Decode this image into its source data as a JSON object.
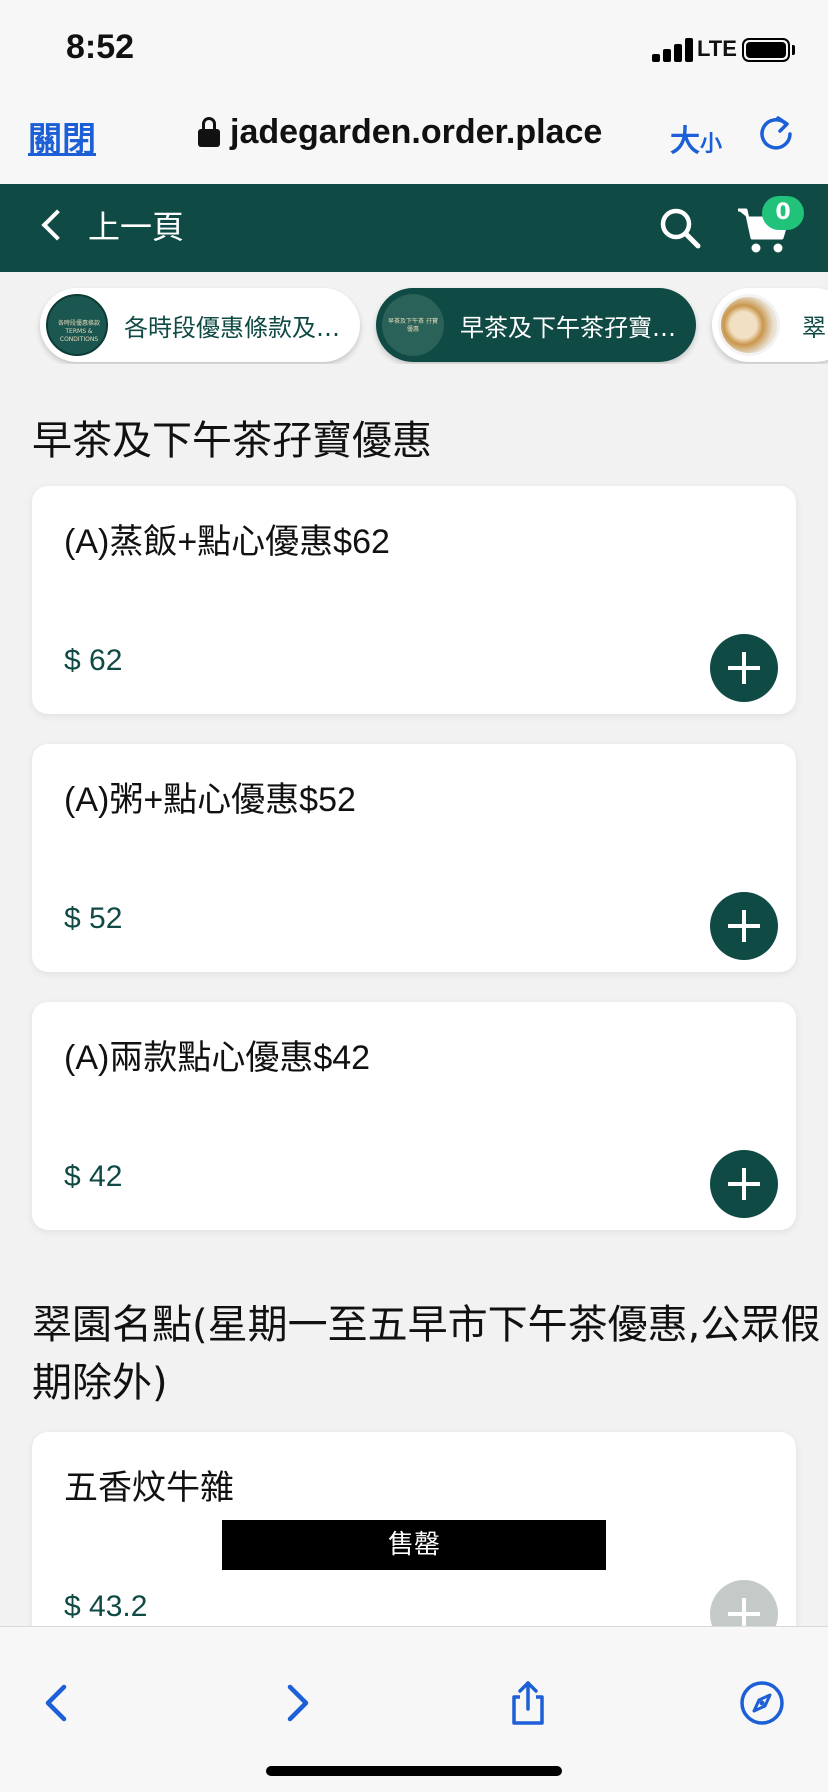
{
  "status_bar": {
    "time": "8:52",
    "network": "LTE"
  },
  "browser": {
    "close_label": "關閉",
    "url": "jadegarden.order.place",
    "text_size_label_big": "大",
    "text_size_label_small": "小"
  },
  "header": {
    "back_label": "上一頁",
    "cart_count": "0"
  },
  "chips": [
    {
      "label": "各時段優惠條款及細則",
      "thumb_text": "各時段優惠條款 TERMS & CONDITIONS"
    },
    {
      "label": "早茶及下午茶孖寶優惠",
      "thumb_text": "早茶及下午茶 孖寶優惠"
    },
    {
      "label": "翠園名點"
    }
  ],
  "sections": [
    {
      "title": "早茶及下午茶孖寶優惠",
      "items": [
        {
          "name": "(A)蒸飯+點心優惠$62",
          "price": "$ 62"
        },
        {
          "name": "(A)粥+點心優惠$52",
          "price": "$ 52"
        },
        {
          "name": "(A)兩款點心優惠$42",
          "price": "$ 42"
        }
      ]
    },
    {
      "title": "翠園名點(星期一至五早市下午茶優惠,公眾假期除外)",
      "items": [
        {
          "name": "五香炆牛雜",
          "price": "$ 43.2",
          "badge": "售罄"
        }
      ]
    }
  ],
  "colors": {
    "brand": "#0f4a44",
    "badge": "#21c27a",
    "link": "#1c5fd6"
  }
}
